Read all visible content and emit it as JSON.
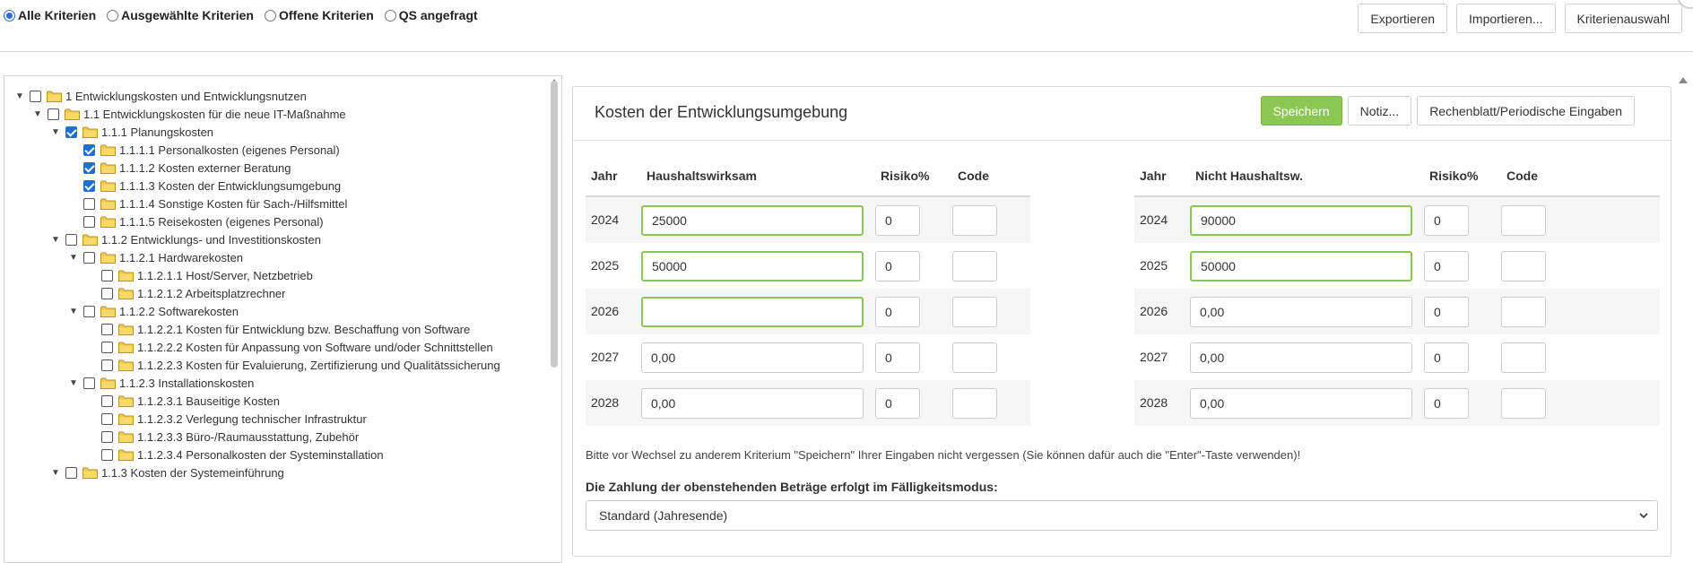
{
  "filters": {
    "options": [
      {
        "label": "Alle Kriterien",
        "selected": true
      },
      {
        "label": "Ausgewählte Kriterien",
        "selected": false
      },
      {
        "label": "Offene Kriterien",
        "selected": false
      },
      {
        "label": "QS angefragt",
        "selected": false
      }
    ]
  },
  "toolbar": {
    "export_label": "Exportieren",
    "import_label": "Importieren...",
    "criteria_label": "Kriterienauswahl"
  },
  "tree": [
    {
      "label": "1 Entwicklungskosten und Entwicklungsnutzen",
      "level": 0,
      "toggle": "down",
      "checked": false
    },
    {
      "label": "1.1 Entwicklungskosten für die neue IT-Maßnahme",
      "level": 1,
      "toggle": "down",
      "checked": false
    },
    {
      "label": "1.1.1 Planungskosten",
      "level": 2,
      "toggle": "down",
      "checked": true
    },
    {
      "label": "1.1.1.1 Personalkosten (eigenes Personal)",
      "level": 3,
      "toggle": "none",
      "checked": true
    },
    {
      "label": "1.1.1.2 Kosten externer Beratung",
      "level": 3,
      "toggle": "none",
      "checked": true
    },
    {
      "label": "1.1.1.3 Kosten der Entwicklungsumgebung",
      "level": 3,
      "toggle": "none",
      "checked": true
    },
    {
      "label": "1.1.1.4 Sonstige Kosten für Sach-/Hilfsmittel",
      "level": 3,
      "toggle": "none",
      "checked": false
    },
    {
      "label": "1.1.1.5 Reisekosten (eigenes Personal)",
      "level": 3,
      "toggle": "none",
      "checked": false
    },
    {
      "label": "1.1.2 Entwicklungs- und Investitionskosten",
      "level": 2,
      "toggle": "down",
      "checked": false
    },
    {
      "label": "1.1.2.1 Hardwarekosten",
      "level": 3,
      "toggle": "down",
      "checked": false
    },
    {
      "label": "1.1.2.1.1 Host/Server, Netzbetrieb",
      "level": 4,
      "toggle": "none",
      "checked": false
    },
    {
      "label": "1.1.2.1.2 Arbeitsplatzrechner",
      "level": 4,
      "toggle": "none",
      "checked": false
    },
    {
      "label": "1.1.2.2 Softwarekosten",
      "level": 3,
      "toggle": "down",
      "checked": false
    },
    {
      "label": "1.1.2.2.1 Kosten für Entwicklung bzw. Beschaffung von Software",
      "level": 4,
      "toggle": "none",
      "checked": false
    },
    {
      "label": "1.1.2.2.2 Kosten für Anpassung von Software und/oder Schnittstellen",
      "level": 4,
      "toggle": "none",
      "checked": false
    },
    {
      "label": "1.1.2.2.3 Kosten für Evaluierung, Zertifizierung und Qualitätssicherung",
      "level": 4,
      "toggle": "none",
      "checked": false
    },
    {
      "label": "1.1.2.3 Installationskosten",
      "level": 3,
      "toggle": "down",
      "checked": false
    },
    {
      "label": "1.1.2.3.1 Bauseitige Kosten",
      "level": 4,
      "toggle": "none",
      "checked": false
    },
    {
      "label": "1.1.2.3.2 Verlegung technischer Infrastruktur",
      "level": 4,
      "toggle": "none",
      "checked": false
    },
    {
      "label": "1.1.2.3.3 Büro-/Raumausstattung, Zubehör",
      "level": 4,
      "toggle": "none",
      "checked": false
    },
    {
      "label": "1.1.2.3.4 Personalkosten der Systeminstallation",
      "level": 4,
      "toggle": "none",
      "checked": false
    },
    {
      "label": "1.1.3 Kosten der Systemeinführung",
      "level": 2,
      "toggle": "down",
      "checked": false
    }
  ],
  "card": {
    "title": "Kosten der Entwicklungsumgebung",
    "save_label": "Speichern",
    "note_label": "Notiz...",
    "sheet_label": "Rechenblatt/Periodische Eingaben"
  },
  "left_table": {
    "headers": {
      "year": "Jahr",
      "amount": "Haushaltswirksam",
      "risk": "Risiko%",
      "code": "Code"
    },
    "rows": [
      {
        "year": "2024",
        "amount": "25000",
        "risk": "0",
        "code": "",
        "highlight": true
      },
      {
        "year": "2025",
        "amount": "50000",
        "risk": "0",
        "code": "",
        "highlight": true
      },
      {
        "year": "2026",
        "amount": "",
        "risk": "0",
        "code": "",
        "highlight": true
      },
      {
        "year": "2027",
        "amount": "0,00",
        "risk": "0",
        "code": "",
        "highlight": false
      },
      {
        "year": "2028",
        "amount": "0,00",
        "risk": "0",
        "code": "",
        "highlight": false
      }
    ]
  },
  "right_table": {
    "headers": {
      "year": "Jahr",
      "amount": "Nicht Haushaltsw.",
      "risk": "Risiko%",
      "code": "Code"
    },
    "rows": [
      {
        "year": "2024",
        "amount": "90000",
        "risk": "0",
        "code": "",
        "highlight": true
      },
      {
        "year": "2025",
        "amount": "50000",
        "risk": "0",
        "code": "",
        "highlight": true
      },
      {
        "year": "2026",
        "amount": "0,00",
        "risk": "0",
        "code": "",
        "highlight": false
      },
      {
        "year": "2027",
        "amount": "0,00",
        "risk": "0",
        "code": "",
        "highlight": false
      },
      {
        "year": "2028",
        "amount": "0,00",
        "risk": "0",
        "code": "",
        "highlight": false
      }
    ]
  },
  "hint": "Bitte vor Wechsel zu anderem Kriterium \"Speichern\" Ihrer Eingaben nicht vergessen (Sie können dafür auch die \"Enter\"-Taste verwenden)!",
  "payment_mode": {
    "label": "Die Zahlung der obenstehenden Beträge erfolgt im Fälligkeitsmodus:",
    "selected": "Standard (Jahresende)"
  },
  "colors": {
    "accent_green": "#8cc653",
    "checkbox_blue": "#1f6fd1",
    "folder_yellow": "#f2c94c"
  }
}
